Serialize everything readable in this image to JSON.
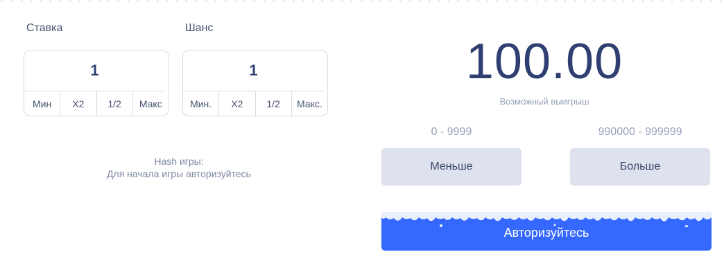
{
  "bet": {
    "label": "Ставка",
    "value": "1",
    "buttons": [
      "Мин",
      "X2",
      "1/2",
      "Макс"
    ]
  },
  "chance": {
    "label": "Шанс",
    "value": "1",
    "buttons": [
      "Мин.",
      "X2",
      "1/2",
      "Макс."
    ]
  },
  "hash": {
    "title": "Hash игры:",
    "text": "Для начала игры авторизуйтесь"
  },
  "payout": {
    "value": "100.00",
    "caption": "Возможный выигрыш"
  },
  "ranges": {
    "low": "0 - 9999",
    "high": "990000 - 999999"
  },
  "choices": {
    "low": "Меньше",
    "high": "Больше"
  },
  "auth_button": "Авторизуйтесь",
  "colors": {
    "primary": "#3468ff",
    "text_dark": "#2f3f72",
    "choice_bg": "#dde2ee"
  }
}
